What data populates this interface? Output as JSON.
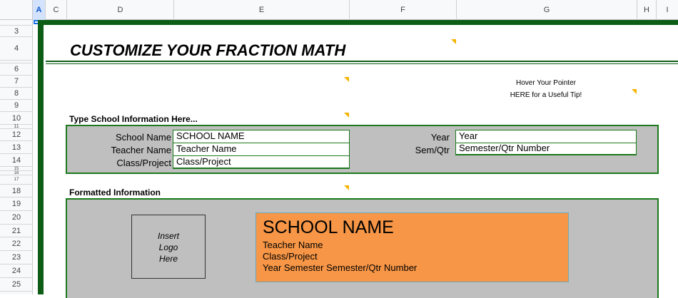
{
  "columns": [
    "A",
    "C",
    "D",
    "E",
    "F",
    "G",
    "H",
    "I"
  ],
  "rows": [
    "3",
    "4",
    "6",
    "7",
    "8",
    "9",
    "10",
    "11",
    "12",
    "13",
    "14",
    "15",
    "16",
    "17",
    "18",
    "19",
    "20",
    "21",
    "22",
    "23",
    "24",
    "25"
  ],
  "title": "CUSTOMIZE YOUR FRACTION MATH",
  "tip": {
    "line1": "Hover Your Pointer",
    "line2": "HERE for a Useful Tip!"
  },
  "school_section": {
    "heading": "Type School Information Here...",
    "fields": {
      "school_name": {
        "label": "School Name",
        "value": "SCHOOL NAME"
      },
      "teacher_name": {
        "label": "Teacher Name",
        "value": "Teacher Name"
      },
      "class_project": {
        "label": "Class/Project",
        "value": "Class/Project"
      },
      "year": {
        "label": "Year",
        "value": "Year"
      },
      "sem_qtr": {
        "label": "Sem/Qtr",
        "value": "Semester/Qtr Number"
      }
    }
  },
  "formatted_section": {
    "heading": "Formatted Information",
    "logo_placeholder": {
      "line1": "Insert",
      "line2": "Logo",
      "line3": "Here"
    },
    "card": {
      "school_name": "SCHOOL NAME",
      "teacher_name": "Teacher Name",
      "class_project": "Class/Project",
      "year_semester": "Year Semester Semester/Qtr Number"
    }
  },
  "colors": {
    "accent_green": "#0d5d16",
    "panel_gray": "#bfbfbf",
    "card_orange": "#f79646",
    "comment_flag": "#f4b400",
    "selection_blue": "#d3e3fd"
  }
}
